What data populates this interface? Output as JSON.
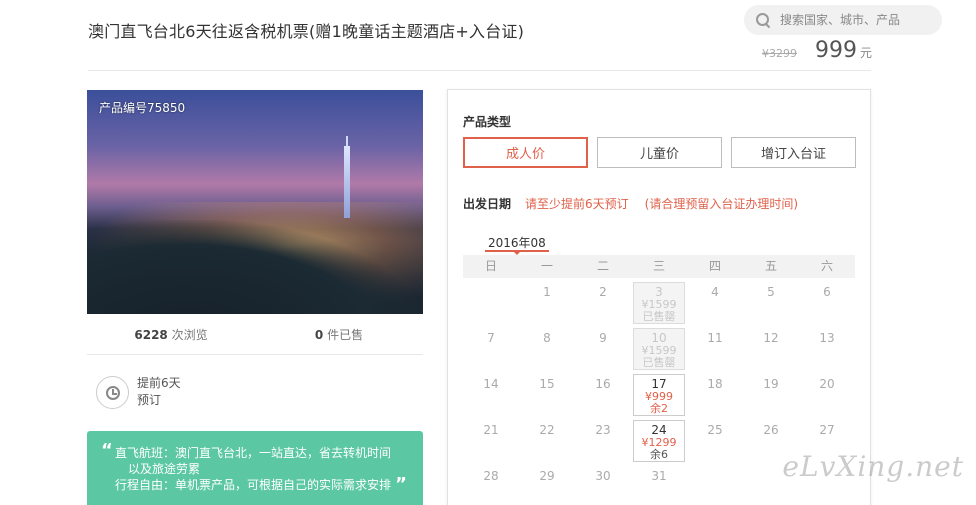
{
  "header": {
    "title": "澳门直飞台北6天往返含税机票(赠1晚童话主题酒店+入台证)",
    "search_placeholder": "搜索国家、城市、产品",
    "old_price": "¥3299",
    "price": "999",
    "price_unit": "元"
  },
  "gallery": {
    "product_code": "产品编号75850"
  },
  "stats": {
    "views_count": "6228",
    "views_label": " 次浏览",
    "sold_count": "0",
    "sold_label": " 件已售"
  },
  "booking": {
    "advance_line1": "提前6天",
    "advance_line2": "预订"
  },
  "feature": {
    "line1": "直飞航班：澳门直飞台北，一站直达，省去转机时间",
    "line2": "以及旅途劳累",
    "line3": "行程自由：单机票产品，可根据自己的实际需求安排"
  },
  "panel": {
    "product_type_label": "产品类型",
    "types": [
      "成人价",
      "儿童价",
      "增订入台证"
    ],
    "active_type_index": 0,
    "depart_label": "出发日期",
    "notice1": "请至少提前6天预订",
    "notice2": "(请合理预留入台证办理时间)",
    "month": "2016年08",
    "weekdays": [
      "日",
      "一",
      "二",
      "三",
      "四",
      "五",
      "六"
    ],
    "rows": [
      [
        {
          "d": ""
        },
        {
          "d": "1"
        },
        {
          "d": "2"
        },
        {
          "d": "3",
          "price": "¥1599",
          "status": "已售罄",
          "type": "soldout"
        },
        {
          "d": "4"
        },
        {
          "d": "5"
        },
        {
          "d": "6"
        }
      ],
      [
        {
          "d": "7"
        },
        {
          "d": "8"
        },
        {
          "d": "9"
        },
        {
          "d": "10",
          "price": "¥1599",
          "status": "已售罄",
          "type": "soldout"
        },
        {
          "d": "11"
        },
        {
          "d": "12"
        },
        {
          "d": "13"
        }
      ],
      [
        {
          "d": "14"
        },
        {
          "d": "15"
        },
        {
          "d": "16"
        },
        {
          "d": "17",
          "price": "¥999",
          "status": "余2",
          "type": "avail"
        },
        {
          "d": "18"
        },
        {
          "d": "19"
        },
        {
          "d": "20"
        }
      ],
      [
        {
          "d": "21"
        },
        {
          "d": "22"
        },
        {
          "d": "23"
        },
        {
          "d": "24",
          "price": "¥1299",
          "status": "余6",
          "type": "avail",
          "dark_status": true
        },
        {
          "d": "25"
        },
        {
          "d": "26"
        },
        {
          "d": "27"
        }
      ],
      [
        {
          "d": "28"
        },
        {
          "d": "29"
        },
        {
          "d": "30"
        },
        {
          "d": "31"
        },
        {
          "d": ""
        },
        {
          "d": ""
        },
        {
          "d": ""
        }
      ]
    ]
  },
  "watermark": "eLvXing.net"
}
